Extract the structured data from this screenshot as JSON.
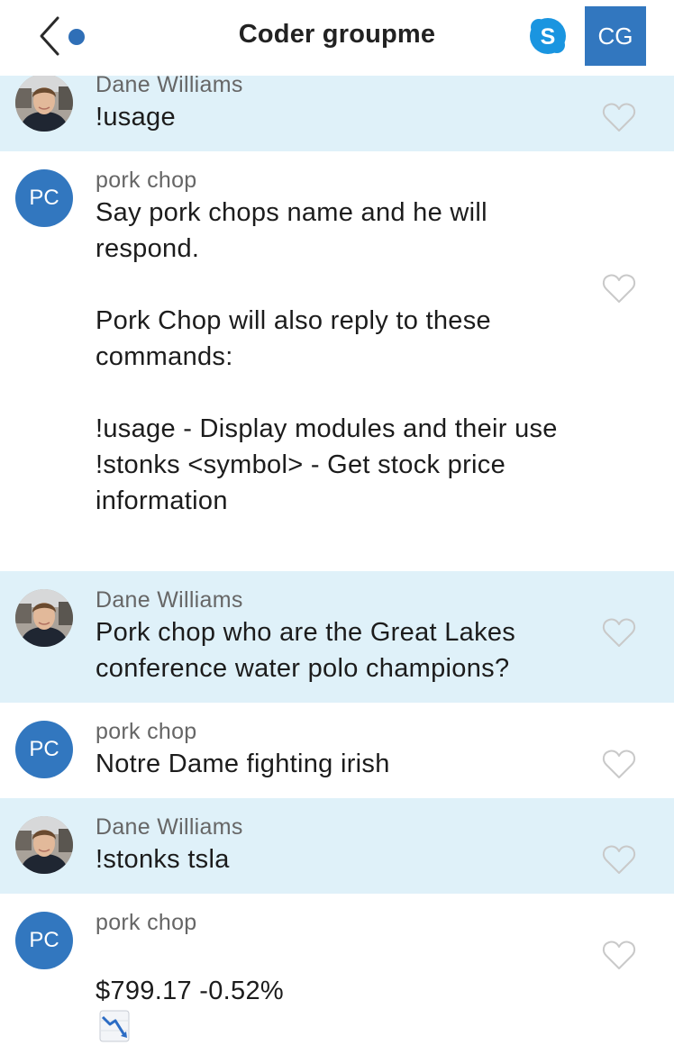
{
  "header": {
    "title": "Coder groupme",
    "group_initials": "CG"
  },
  "messages": [
    {
      "sender": "Dane Williams",
      "text": "!usage",
      "self": true
    },
    {
      "sender": "pork chop",
      "initials": "PC",
      "text": "Say pork chops name and he will respond.\n\nPork Chop will also reply to these commands:\n\n!usage - Display modules and their use\n!stonks <symbol> - Get stock price information"
    },
    {
      "sender": "Dane Williams",
      "text": "Pork chop who are the Great Lakes conference water polo champions?",
      "self": true
    },
    {
      "sender": "pork chop",
      "initials": "PC",
      "text": "Notre Dame fighting irish"
    },
    {
      "sender": "Dane Williams",
      "text": "!stonks tsla",
      "self": true
    },
    {
      "sender": "pork chop",
      "initials": "PC",
      "text": "$799.17 -0.52%",
      "emoji": "chart-decreasing-icon"
    }
  ]
}
